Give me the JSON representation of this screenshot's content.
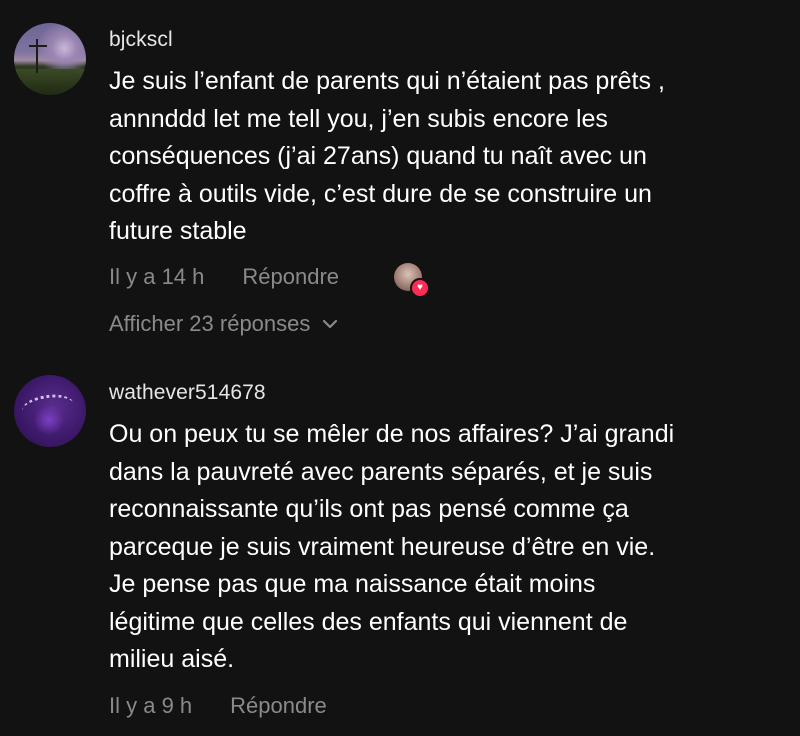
{
  "comments": [
    {
      "username": "bjckscl",
      "text": "Je suis l’enfant de parents qui n’étaient pas prêts , annnddd let me tell you, j’en subis encore les conséquences (j’ai 27ans) quand tu naît avec un coffre à outils vide, c’est dure de se construire un future stable",
      "lines": [
        "Je suis l’enfant de parents qui n’étaient pas prêts ,",
        "annnddd let me tell you, j’en subis encore les",
        "conséquences (j’ai 27ans) quand tu naît avec un",
        "coffre à outils vide, c’est dure de se construire un",
        "future stable"
      ],
      "time": "Il y a 14 h",
      "reply_label": "Répondre",
      "liked_by_creator_icon": "heart-icon",
      "view_replies": "Afficher 23 réponses"
    },
    {
      "username": "wathever514678",
      "text": "Ou on peux tu se mêler de nos affaires? J’ai grandi dans la pauvreté avec parents séparés, et je suis reconnaissante qu’ils ont pas pensé comme ça parceque je suis vraiment heureuse d’être en vie. Je pense pas que ma naissance était moins légitime que celles des enfants qui viennent de milieu aisé.",
      "lines": [
        "Ou on peux tu se mêler de nos affaires? J’ai grandi",
        "dans la pauvreté avec parents séparés, et je suis",
        "reconnaissante qu’ils ont pas pensé comme ça",
        "parceque je suis vraiment heureuse d’être en vie.",
        "Je pense pas que ma naissance était moins",
        "légitime que celles des enfants qui viennent de",
        "milieu aisé."
      ],
      "time": "Il y a 9 h",
      "reply_label": "Répondre"
    }
  ],
  "colors": {
    "background": "#121212",
    "secondary_text": "#8a8a8a",
    "heart_badge": "#fe2c55"
  }
}
